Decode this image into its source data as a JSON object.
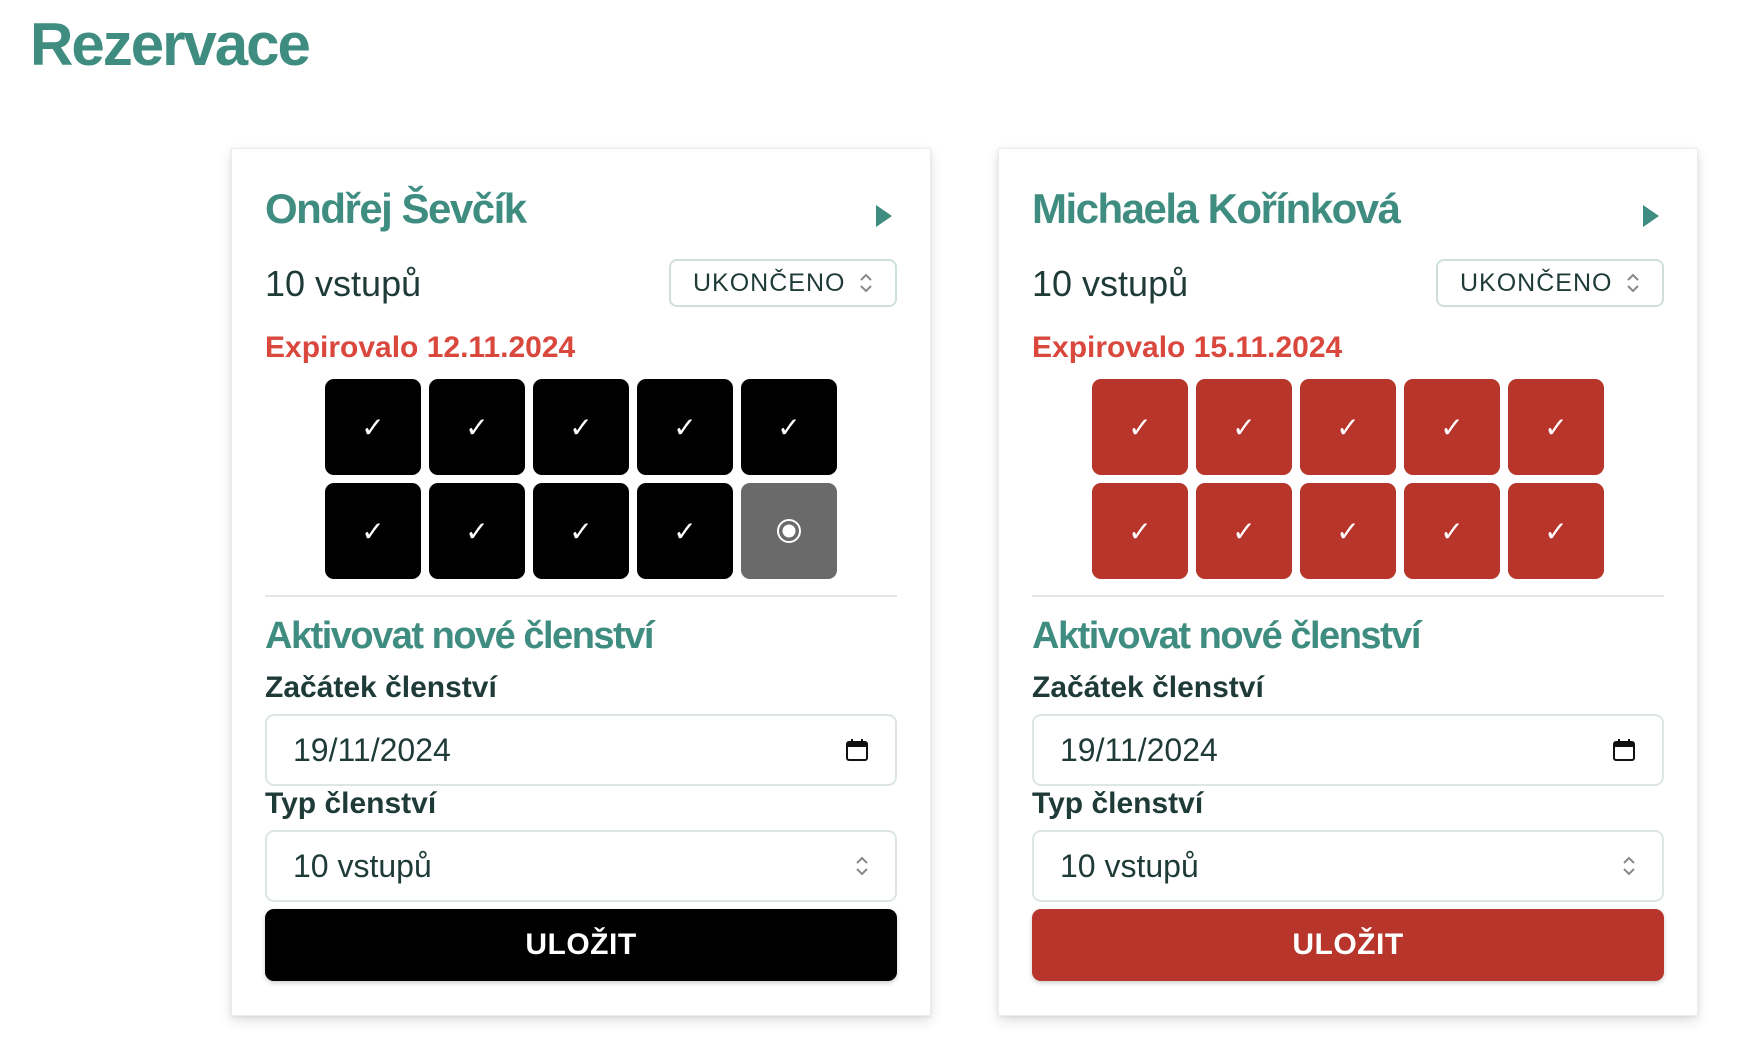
{
  "page": {
    "title": "Rezervace"
  },
  "cards": [
    {
      "name": "Ondřej Ševčík",
      "entries_label": "10 vstupů",
      "status": "UKONČENO",
      "expired": "Expirovalo 12.11.2024",
      "accent": "#000000",
      "used_entries": 9,
      "total_entries": 10,
      "new_section": "Aktivovat nové členství",
      "start_label": "Začátek členství",
      "start_value": "19/11/2024",
      "type_label": "Typ členství",
      "type_value": "10 vstupů",
      "save_label": "ULOŽIT"
    },
    {
      "name": "Michaela Kořínková",
      "entries_label": "10 vstupů",
      "status": "UKONČENO",
      "expired": "Expirovalo 15.11.2024",
      "accent": "#b8352b",
      "used_entries": 10,
      "total_entries": 10,
      "new_section": "Aktivovat nové členství",
      "start_label": "Začátek členství",
      "start_value": "19/11/2024",
      "type_label": "Typ členství",
      "type_value": "10 vstupů",
      "save_label": "ULOŽIT"
    }
  ],
  "icons": {
    "check": "✓",
    "expand": "play-icon",
    "pending": "radio-pending-icon",
    "calendar": "calendar-icon",
    "select": "chevron-updown-icon"
  },
  "colors": {
    "title": "#3f8c80",
    "expired": "#d9473d",
    "used_black": "#000000",
    "used_red": "#b8352b",
    "pending": "#6a6a6a"
  }
}
